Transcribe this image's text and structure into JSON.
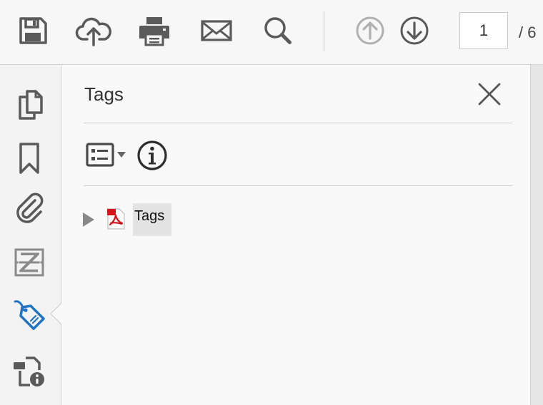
{
  "toolbar": {
    "buttons": [
      {
        "name": "save",
        "icon": "floppy-disk-icon"
      },
      {
        "name": "upload",
        "icon": "cloud-upload-icon"
      },
      {
        "name": "print",
        "icon": "printer-icon"
      },
      {
        "name": "email",
        "icon": "envelope-icon"
      },
      {
        "name": "search",
        "icon": "magnifier-icon"
      },
      {
        "name": "previous-page",
        "icon": "arrow-up-circle-icon",
        "state": "disabled"
      },
      {
        "name": "next-page",
        "icon": "arrow-down-circle-icon"
      }
    ],
    "page_number": "1",
    "page_total": "/ 6"
  },
  "left_rail": {
    "items": [
      {
        "name": "pages",
        "icon": "pages-icon"
      },
      {
        "name": "bookmarks",
        "icon": "bookmark-icon"
      },
      {
        "name": "attachments",
        "icon": "paperclip-icon"
      },
      {
        "name": "layers",
        "icon": "layers-icon"
      },
      {
        "name": "tags",
        "icon": "tag-icon",
        "active": true
      },
      {
        "name": "order",
        "icon": "content-info-icon"
      }
    ]
  },
  "panel": {
    "title": "Tags",
    "tree": [
      {
        "label": "Tags",
        "icon": "pdf-icon",
        "expanded": false
      }
    ]
  },
  "colors": {
    "accent": "#1f74c4",
    "icon_gray": "#5a5a5a",
    "disabled_gray": "#b0b0b0",
    "pdf_red": "#d4161c"
  }
}
